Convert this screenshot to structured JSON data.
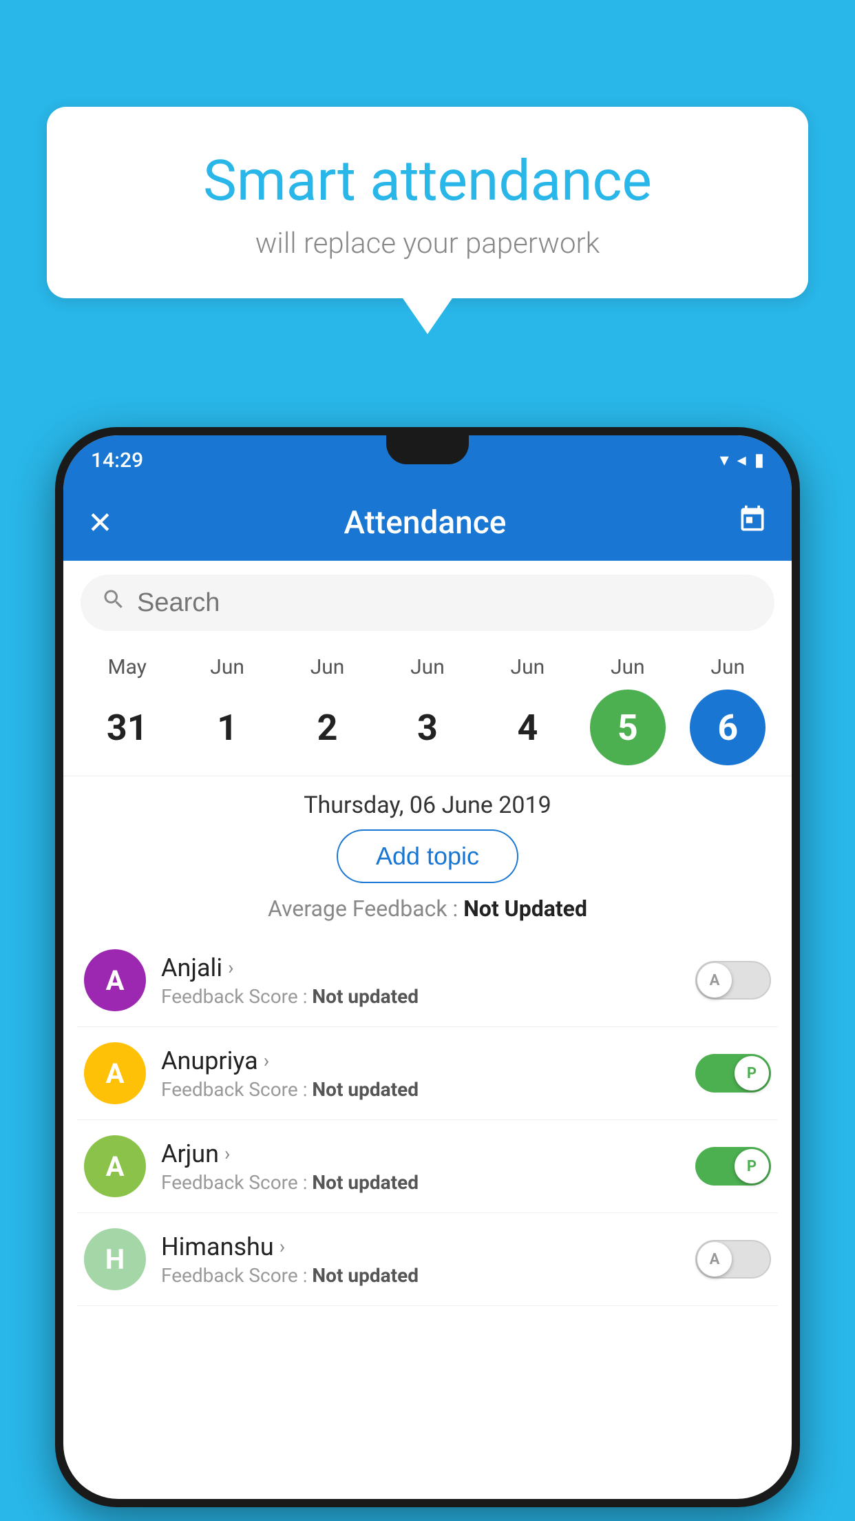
{
  "background": {
    "color": "#29B6E8"
  },
  "speech_bubble": {
    "title": "Smart attendance",
    "subtitle": "will replace your paperwork"
  },
  "status_bar": {
    "time": "14:29",
    "wifi_icon": "▾",
    "signal_icon": "◂",
    "battery_icon": "▮"
  },
  "app_bar": {
    "close_icon": "✕",
    "title": "Attendance",
    "calendar_icon": "📅"
  },
  "search": {
    "placeholder": "Search"
  },
  "calendar": {
    "items": [
      {
        "month": "May",
        "day": "31",
        "state": "normal"
      },
      {
        "month": "Jun",
        "day": "1",
        "state": "normal"
      },
      {
        "month": "Jun",
        "day": "2",
        "state": "normal"
      },
      {
        "month": "Jun",
        "day": "3",
        "state": "normal"
      },
      {
        "month": "Jun",
        "day": "4",
        "state": "normal"
      },
      {
        "month": "Jun",
        "day": "5",
        "state": "today"
      },
      {
        "month": "Jun",
        "day": "6",
        "state": "selected"
      }
    ]
  },
  "selected_date": "Thursday, 06 June 2019",
  "add_topic_label": "Add topic",
  "avg_feedback_label": "Average Feedback :",
  "avg_feedback_value": "Not Updated",
  "students": [
    {
      "name": "Anjali",
      "feedback_label": "Feedback Score :",
      "feedback_value": "Not updated",
      "avatar_letter": "A",
      "avatar_color": "#9C27B0",
      "toggle_state": "off",
      "toggle_letter": "A"
    },
    {
      "name": "Anupriya",
      "feedback_label": "Feedback Score :",
      "feedback_value": "Not updated",
      "avatar_letter": "A",
      "avatar_color": "#FFC107",
      "toggle_state": "on",
      "toggle_letter": "P"
    },
    {
      "name": "Arjun",
      "feedback_label": "Feedback Score :",
      "feedback_value": "Not updated",
      "avatar_letter": "A",
      "avatar_color": "#8BC34A",
      "toggle_state": "on",
      "toggle_letter": "P"
    },
    {
      "name": "Himanshu",
      "feedback_label": "Feedback Score :",
      "feedback_value": "Not updated",
      "avatar_letter": "H",
      "avatar_color": "#A5D6A7",
      "toggle_state": "off",
      "toggle_letter": "A"
    }
  ]
}
